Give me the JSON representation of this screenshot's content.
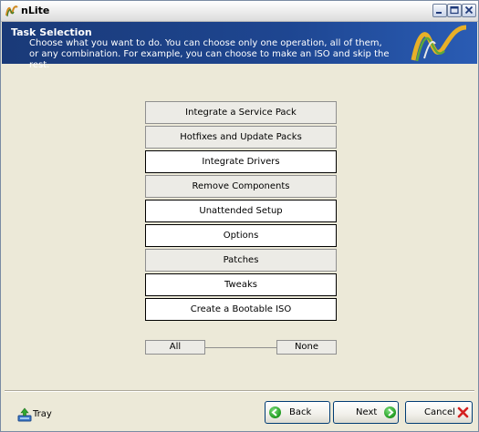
{
  "window": {
    "title": "nLite"
  },
  "header": {
    "title": "Task Selection",
    "description": "Choose what you want to do. You can choose only one operation, all of them, or any combination. For example, you can choose to make an ISO and skip the rest."
  },
  "tasks": [
    {
      "label": "Integrate a Service Pack",
      "selected": false
    },
    {
      "label": "Hotfixes and Update Packs",
      "selected": false
    },
    {
      "label": "Integrate Drivers",
      "selected": true
    },
    {
      "label": "Remove Components",
      "selected": false
    },
    {
      "label": "Unattended Setup",
      "selected": true
    },
    {
      "label": "Options",
      "selected": true
    },
    {
      "label": "Patches",
      "selected": false
    },
    {
      "label": "Tweaks",
      "selected": true
    },
    {
      "label": "Create a Bootable ISO",
      "selected": true
    }
  ],
  "selection": {
    "all_label": "All",
    "none_label": "None"
  },
  "footer": {
    "tray_label": "Tray",
    "back_label": "Back",
    "next_label": "Next",
    "cancel_label": "Cancel"
  },
  "icons": {
    "app": "nlite-logo-icon",
    "back": "green-left-arrow-icon",
    "next": "green-right-arrow-icon",
    "cancel": "red-x-icon",
    "tray": "tray-icon"
  },
  "colors": {
    "banner": "#1E4691",
    "task_selected_bg": "#FFFFFF",
    "task_unselected_bg": "#ECEBE6",
    "window_bg": "#ECE9D8"
  }
}
